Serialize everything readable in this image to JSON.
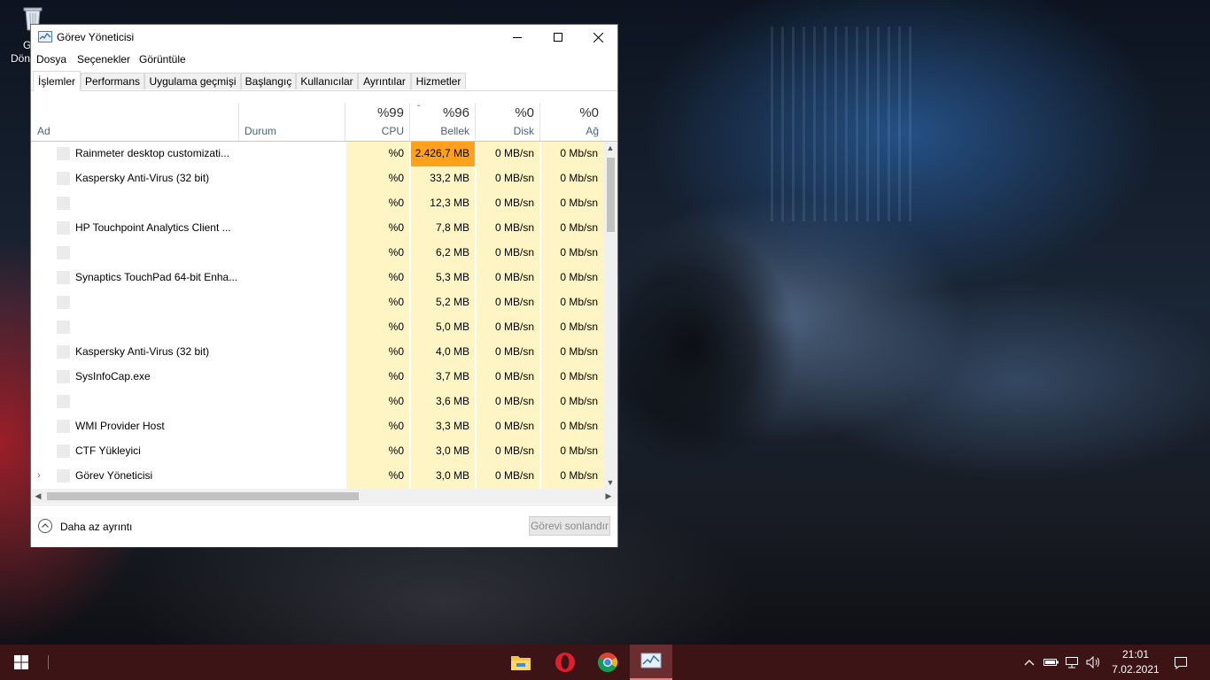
{
  "desktop": {
    "recycle_bin_label": "G\nDön"
  },
  "window": {
    "title": "Görev Yöneticisi",
    "menu": [
      "Dosya",
      "Seçenekler",
      "Görüntüle"
    ],
    "tabs": [
      "İşlemler",
      "Performans",
      "Uygulama geçmişi",
      "Başlangıç",
      "Kullanıcılar",
      "Ayrıntılar",
      "Hizmetler"
    ],
    "active_tab": "İşlemler"
  },
  "columns": {
    "name": {
      "label": "Ad"
    },
    "status": {
      "label": "Durum"
    },
    "cpu": {
      "percent": "%99",
      "label": "CPU"
    },
    "memory": {
      "percent": "%96",
      "label": "Bellek",
      "sort_indicator": "ˇ"
    },
    "disk": {
      "percent": "%0",
      "label": "Disk"
    },
    "network": {
      "percent": "%0",
      "label": "Ağ"
    }
  },
  "processes": [
    {
      "name": "Rainmeter desktop customizati...",
      "cpu": "%0",
      "memory": "2.426,7 MB",
      "disk": "0 MB/sn",
      "network": "0 Mb/sn",
      "hot": true
    },
    {
      "name": "Kaspersky Anti-Virus (32 bit)",
      "cpu": "%0",
      "memory": "33,2 MB",
      "disk": "0 MB/sn",
      "network": "0 Mb/sn"
    },
    {
      "name": "",
      "cpu": "%0",
      "memory": "12,3 MB",
      "disk": "0 MB/sn",
      "network": "0 Mb/sn"
    },
    {
      "name": "HP Touchpoint Analytics Client ...",
      "cpu": "%0",
      "memory": "7,8 MB",
      "disk": "0 MB/sn",
      "network": "0 Mb/sn"
    },
    {
      "name": "",
      "cpu": "%0",
      "memory": "6,2 MB",
      "disk": "0 MB/sn",
      "network": "0 Mb/sn"
    },
    {
      "name": "Synaptics TouchPad 64-bit Enha...",
      "cpu": "%0",
      "memory": "5,3 MB",
      "disk": "0 MB/sn",
      "network": "0 Mb/sn"
    },
    {
      "name": "",
      "cpu": "%0",
      "memory": "5,2 MB",
      "disk": "0 MB/sn",
      "network": "0 Mb/sn"
    },
    {
      "name": "",
      "cpu": "%0",
      "memory": "5,0 MB",
      "disk": "0 MB/sn",
      "network": "0 Mb/sn"
    },
    {
      "name": "Kaspersky Anti-Virus (32 bit)",
      "cpu": "%0",
      "memory": "4,0 MB",
      "disk": "0 MB/sn",
      "network": "0 Mb/sn"
    },
    {
      "name": "SysInfoCap.exe",
      "cpu": "%0",
      "memory": "3,7 MB",
      "disk": "0 MB/sn",
      "network": "0 Mb/sn"
    },
    {
      "name": "",
      "cpu": "%0",
      "memory": "3,6 MB",
      "disk": "0 MB/sn",
      "network": "0 Mb/sn"
    },
    {
      "name": "WMI Provider Host",
      "cpu": "%0",
      "memory": "3,3 MB",
      "disk": "0 MB/sn",
      "network": "0 Mb/sn"
    },
    {
      "name": "CTF Yükleyici",
      "cpu": "%0",
      "memory": "3,0 MB",
      "disk": "0 MB/sn",
      "network": "0 Mb/sn"
    },
    {
      "name": "Görev Yöneticisi",
      "cpu": "%0",
      "memory": "3,0 MB",
      "disk": "0 MB/sn",
      "network": "0 Mb/sn",
      "expandable": true
    }
  ],
  "footer": {
    "less_details": "Daha az ayrıntı",
    "end_task": "Görevi sonlandır"
  },
  "taskbar": {
    "apps": [
      "file-explorer-icon",
      "opera-icon",
      "chrome-icon",
      "task-manager-icon"
    ],
    "clock_time": "21:01",
    "clock_date": "7.02.2021"
  },
  "colors": {
    "cpu_col_bg": "#fff4c4",
    "memory_hot_bg": "#ffa11a",
    "taskbar_bg": "#3d1416"
  }
}
